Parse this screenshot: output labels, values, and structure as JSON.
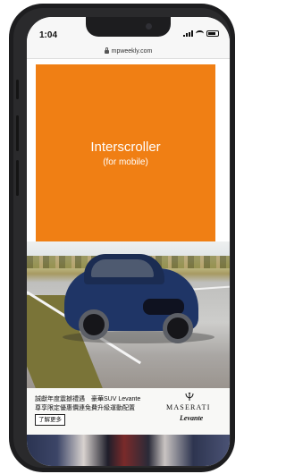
{
  "status_bar": {
    "time": "1:04"
  },
  "browser": {
    "url": "mpweekly.com"
  },
  "ad": {
    "title": "Interscroller",
    "subtitle": "(for mobile)"
  },
  "banner": {
    "line1": "誠獻年度震撼禮遇　豪華SUV Levante",
    "line2": "尊享限定優惠價連免費升級運動配置",
    "learn_more": "了解更多",
    "brand": "MASERATI",
    "model": "Levante"
  },
  "colors": {
    "ad_orange": "#f07f14",
    "phone_frame": "#1d1d1f",
    "car_blue": "#1f3566"
  }
}
